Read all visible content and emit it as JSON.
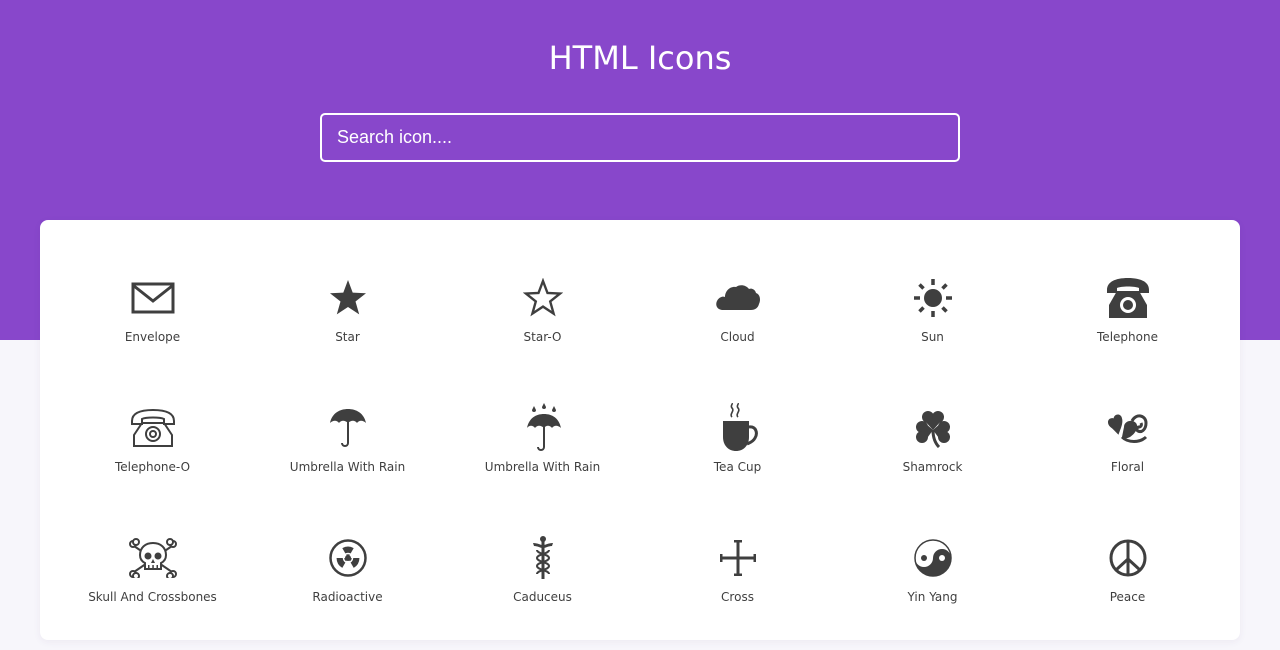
{
  "header": {
    "title": "HTML Icons",
    "search_placeholder": "Search icon...."
  },
  "colors": {
    "hero": "#8847cb",
    "icon": "#3f3f3f",
    "page": "#f7f6fb"
  },
  "icons": [
    {
      "name": "Envelope",
      "icon": "envelope-icon"
    },
    {
      "name": "Star",
      "icon": "star-icon"
    },
    {
      "name": "Star-O",
      "icon": "star-outline-icon"
    },
    {
      "name": "Cloud",
      "icon": "cloud-icon"
    },
    {
      "name": "Sun",
      "icon": "sun-icon"
    },
    {
      "name": "Telephone",
      "icon": "telephone-icon"
    },
    {
      "name": "Telephone-O",
      "icon": "telephone-outline-icon"
    },
    {
      "name": "Umbrella With Rain",
      "icon": "umbrella-icon"
    },
    {
      "name": "Umbrella With Rain",
      "icon": "umbrella-with-rain-icon"
    },
    {
      "name": "Tea Cup",
      "icon": "tea-cup-icon"
    },
    {
      "name": "Shamrock",
      "icon": "shamrock-icon"
    },
    {
      "name": "Floral",
      "icon": "floral-heart-icon"
    },
    {
      "name": "Skull And Crossbones",
      "icon": "skull-crossbones-icon"
    },
    {
      "name": "Radioactive",
      "icon": "radioactive-icon"
    },
    {
      "name": "Caduceus",
      "icon": "caduceus-icon"
    },
    {
      "name": "Cross",
      "icon": "cross-icon"
    },
    {
      "name": "Yin Yang",
      "icon": "yin-yang-icon"
    },
    {
      "name": "Peace",
      "icon": "peace-icon"
    }
  ]
}
